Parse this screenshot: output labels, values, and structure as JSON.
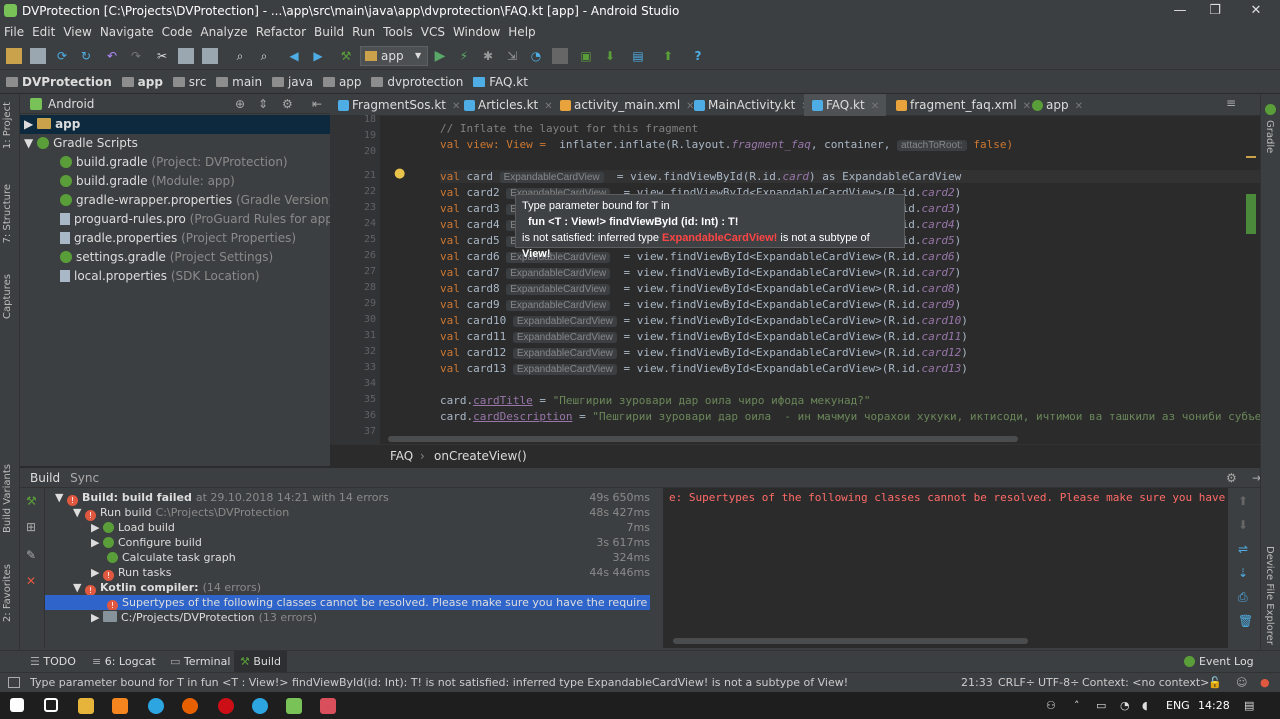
{
  "window": {
    "title": "DVProtection [C:\\Projects\\DVProtection] - ...\\app\\src\\main\\java\\app\\dvprotection\\FAQ.kt [app] - Android Studio",
    "minimize": "—",
    "maximize": "❐",
    "close": "✕"
  },
  "menu": [
    "File",
    "Edit",
    "View",
    "Navigate",
    "Code",
    "Analyze",
    "Refactor",
    "Build",
    "Run",
    "Tools",
    "VCS",
    "Window",
    "Help"
  ],
  "toolbar": {
    "run_config": "app"
  },
  "nav": [
    "DVProtection",
    "app",
    "src",
    "main",
    "java",
    "app",
    "dvprotection",
    "FAQ.kt"
  ],
  "project": {
    "selector": "Android",
    "rows": [
      {
        "label": "app",
        "hint": ""
      },
      {
        "label": "Gradle Scripts",
        "hint": ""
      },
      {
        "label": "build.gradle",
        "hint": "(Project: DVProtection)"
      },
      {
        "label": "build.gradle",
        "hint": "(Module: app)"
      },
      {
        "label": "gradle-wrapper.properties",
        "hint": "(Gradle Version)"
      },
      {
        "label": "proguard-rules.pro",
        "hint": "(ProGuard Rules for app)"
      },
      {
        "label": "gradle.properties",
        "hint": "(Project Properties)"
      },
      {
        "label": "settings.gradle",
        "hint": "(Project Settings)"
      },
      {
        "label": "local.properties",
        "hint": "(SDK Location)"
      }
    ]
  },
  "left_strip": {
    "project": "1: Project",
    "structure": "7: Structure",
    "captures": "Captures",
    "variants": "Build Variants",
    "favorites": "2: Favorites"
  },
  "right_strip": {
    "gradle": "Gradle",
    "device": "Device File Explorer"
  },
  "tabs": [
    "FragmentSos.kt",
    "Articles.kt",
    "activity_main.xml",
    "MainActivity.kt",
    "FAQ.kt",
    "fragment_faq.xml",
    "app"
  ],
  "editor": {
    "line_numbers": [
      "18",
      "19",
      "20",
      "21",
      "22",
      "23",
      "24",
      "25",
      "26",
      "27",
      "28",
      "29",
      "30",
      "31",
      "32",
      "33",
      "34",
      "35",
      "36",
      "37"
    ],
    "comment": "// Inflate the layout for this fragment",
    "l19_a": "val view: View = ",
    "l19_b": " inflater.inflate(R.layout.",
    "l19_c": "fragment_faq",
    "l19_d": ", container, ",
    "l19_hint": "attachToRoot:",
    "l19_e": " false)",
    "type_hint": "ExpandableCardView",
    "cards": [
      "card2",
      "card3",
      "card4",
      "card5",
      "card6",
      "card7",
      "card8",
      "card9",
      "card10",
      "card11",
      "card12",
      "card13"
    ],
    "find_call": "= view.findViewById<ExpandableCardView>(R.id.",
    "card1_call": "= view.findViewById(R.id.",
    "card1_as": ") as ExpandableCardView",
    "title_prop": "cardTitle",
    "title_str": "\"Пешгирии зуровари дар оила чиро ифода мекунад?\"",
    "desc_prop": "cardDescription",
    "desc_str": "\"Пешгирии зуровари дар оила  - ин мачмуи чорахои хукуки, иктисоди, ичтимои ва ташкили аз чониби субъек"
  },
  "tooltip": {
    "line1": "Type parameter bound for T in",
    "line2": "fun <T : View!> findViewById (id: Int) : T!",
    "line3a": "is not satisfied: inferred type ",
    "line3b": "ExpandableCardView!",
    "line3c": " is not a subtype of ",
    "line3d": "View!"
  },
  "breadcrumb": {
    "cls": "FAQ",
    "method": "onCreateView()"
  },
  "build": {
    "tabs": [
      "Build",
      "Sync"
    ],
    "rows": [
      {
        "label": "Build: build failed",
        "dim": "at 29.10.2018 14:21   with 14 errors",
        "time": "49s 650ms"
      },
      {
        "label": "Run build",
        "dim": "C:\\Projects\\DVProtection",
        "time": "48s 427ms"
      },
      {
        "label": "Load build",
        "dim": "",
        "time": "7ms"
      },
      {
        "label": "Configure build",
        "dim": "",
        "time": "3s 617ms"
      },
      {
        "label": "Calculate task graph",
        "dim": "",
        "time": "324ms"
      },
      {
        "label": "Run tasks",
        "dim": "",
        "time": "44s 446ms"
      },
      {
        "label": "Kotlin compiler:",
        "dim": "(14 errors)",
        "time": ""
      },
      {
        "label": "Supertypes of the following classes cannot be resolved. Please make sure you have the require",
        "dim": "",
        "time": ""
      },
      {
        "label": "C:/Projects/DVProtection",
        "dim": "(13 errors)",
        "time": ""
      }
    ],
    "output": "e: Supertypes of the following classes cannot be resolved. Please make sure you have t"
  },
  "bottom_tabs": [
    "TODO",
    "6: Logcat",
    "Terminal",
    "Build"
  ],
  "event_log": "Event Log",
  "status": {
    "message": "Type parameter bound for T in fun <T : View!> findViewById(id: Int): T! is not satisfied: inferred type ExpandableCardView! is not a subtype of View!",
    "position": "21:33",
    "line_sep": "CRLF÷",
    "encoding": "UTF-8÷",
    "context": "Context: <no context>"
  },
  "taskbar": {
    "lang": "ENG",
    "time": "14:28"
  }
}
